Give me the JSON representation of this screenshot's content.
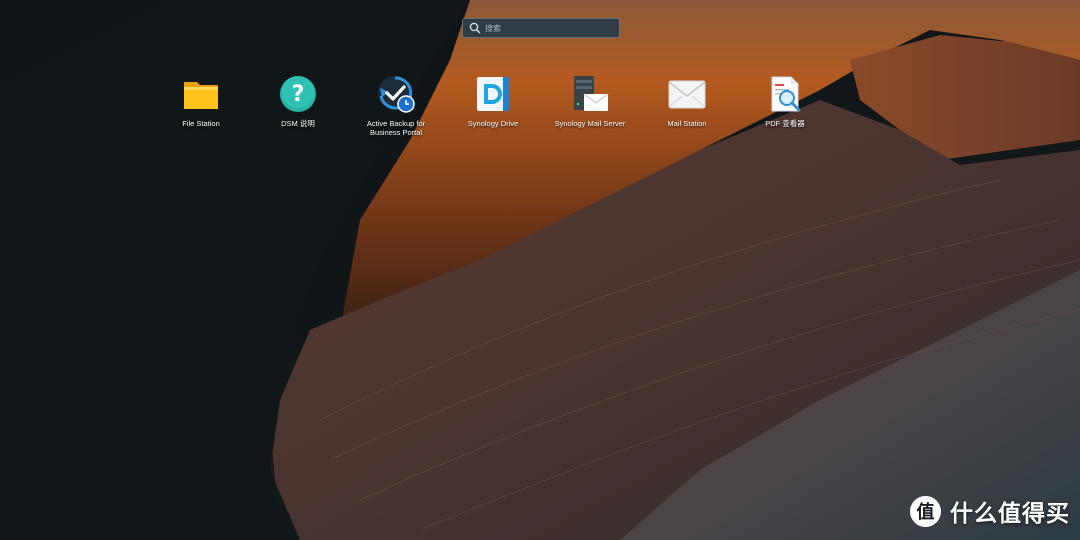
{
  "desktop": {
    "wallpaper": "Antelope Canyon sandstone wallpaper",
    "colors": {
      "search_bg": "#283846",
      "text": "#ffffff",
      "rock_orange": "#b35a1f",
      "rock_dark": "#3d2a26"
    }
  },
  "search": {
    "placeholder": "搜索",
    "value": "",
    "icon": "search-icon"
  },
  "apps": [
    {
      "label": "File Station",
      "icon": "folder-icon"
    },
    {
      "label": "DSM 说明",
      "icon": "help-icon"
    },
    {
      "label": "Active Backup for\nBusiness Portal",
      "icon": "backup-icon"
    },
    {
      "label": "Synology Drive",
      "icon": "drive-icon"
    },
    {
      "label": "Synology Mail Server",
      "icon": "mail-server-icon"
    },
    {
      "label": "Mail Station",
      "icon": "mail-icon"
    },
    {
      "label": "PDF 查看器",
      "icon": "pdf-viewer-icon"
    }
  ],
  "watermark": {
    "text": "什么值得买",
    "logo_char": "值"
  }
}
